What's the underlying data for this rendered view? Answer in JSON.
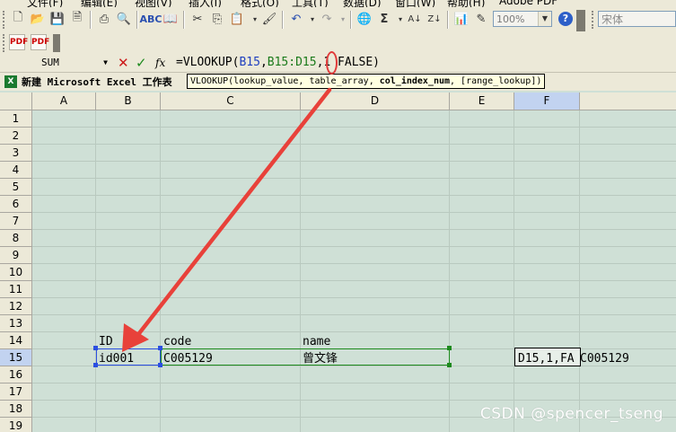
{
  "menu": {
    "items": [
      "文件(F)",
      "编辑(E)",
      "视图(V)",
      "插入(I)",
      "格式(O)",
      "工具(T)",
      "数据(D)",
      "窗口(W)",
      "帮助(H)",
      "Adobe PDF"
    ]
  },
  "toolbar": {
    "zoom_value": "100%",
    "font_value": "宋体"
  },
  "formula_bar": {
    "name_box": "SUM",
    "cancel_symbol": "✕",
    "enter_symbol": "✓",
    "fx_label": "fx",
    "formula_prefix": "=VLOOKUP(",
    "arg1": "B15",
    "sep1": ",",
    "arg2": "B15:D15",
    "arg_rest": ",1 FALSE)"
  },
  "workbook": {
    "title": "新建 Microsoft Excel 工作表"
  },
  "tooltip": {
    "func": "VLOOKUP(",
    "arg1": "lookup_value",
    "arg2": ", table_array, ",
    "arg3_bold": "col_index_num",
    "arg4": ", [range_lookup])"
  },
  "grid": {
    "columns": [
      "A",
      "B",
      "C",
      "D",
      "E",
      "F"
    ],
    "rows": [
      "1",
      "2",
      "3",
      "4",
      "5",
      "6",
      "7",
      "8",
      "9",
      "10",
      "11",
      "12",
      "13",
      "14",
      "15",
      "16",
      "17",
      "18",
      "19"
    ],
    "cells": {
      "B14": "ID",
      "C14": "code",
      "D14": "name",
      "B15": "id001",
      "C15": "C005129",
      "D15": "曾文锋",
      "F15_edit": "D15,1,FA",
      "F15_spill": "C005129"
    }
  },
  "watermark": "CSDN @spencer_tseng"
}
